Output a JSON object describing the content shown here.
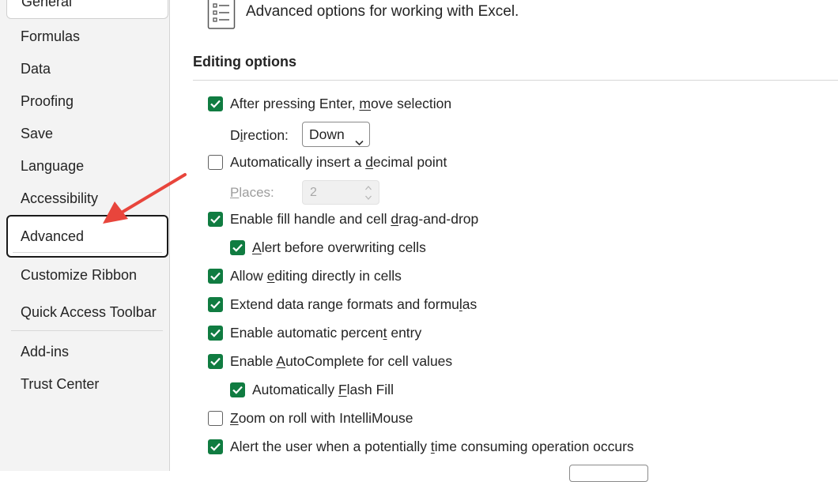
{
  "sidebar": {
    "items": [
      {
        "label": "General"
      },
      {
        "label": "Formulas"
      },
      {
        "label": "Data"
      },
      {
        "label": "Proofing"
      },
      {
        "label": "Save"
      },
      {
        "label": "Language"
      },
      {
        "label": "Accessibility"
      },
      {
        "label": "Advanced"
      },
      {
        "label": "Customize Ribbon"
      },
      {
        "label": "Quick Access Toolbar"
      },
      {
        "label": "Add-ins"
      },
      {
        "label": "Trust Center"
      }
    ],
    "selected": "Advanced"
  },
  "header": {
    "icon": "list-options-icon",
    "text": "Advanced options for working with Excel."
  },
  "section": {
    "title": "Editing options"
  },
  "options": {
    "move_selection": {
      "pre": "After pressing Enter, ",
      "u": "m",
      "post": "ove selection",
      "checked": true
    },
    "direction": {
      "pre": "D",
      "u": "i",
      "post": "rection:",
      "value": "Down"
    },
    "decimal_point": {
      "pre": "Automatically insert a ",
      "u": "d",
      "post": "ecimal point",
      "checked": false
    },
    "places": {
      "pre": "",
      "u": "P",
      "post": "laces:",
      "value": "2"
    },
    "fill_handle": {
      "pre": "Enable fill handle and cell ",
      "u": "d",
      "post": "rag-and-drop",
      "checked": true
    },
    "alert_overwrite": {
      "pre": "",
      "u": "A",
      "post": "lert before overwriting cells",
      "checked": true
    },
    "edit_in_cells": {
      "pre": "Allow ",
      "u": "e",
      "post": "diting directly in cells",
      "checked": true
    },
    "extend_formats": {
      "pre": "Extend data range formats and formu",
      "u": "l",
      "post": "as",
      "checked": true
    },
    "percent_entry": {
      "pre": "Enable automatic percen",
      "u": "t",
      "post": " entry",
      "checked": true
    },
    "autocomplete": {
      "pre": "Enable ",
      "u": "A",
      "post": "utoComplete for cell values",
      "checked": true
    },
    "flash_fill": {
      "pre": "Automatically ",
      "u": "F",
      "post": "lash Fill",
      "checked": true
    },
    "zoom_roll": {
      "pre": "",
      "u": "Z",
      "post": "oom on roll with IntelliMouse",
      "checked": false
    },
    "alert_time": {
      "pre": "Alert the user when a potentially ",
      "u": "t",
      "post": "ime consuming operation occurs",
      "checked": true
    }
  },
  "colors": {
    "accent": "#107c41",
    "annotation_arrow": "#e8453c"
  }
}
